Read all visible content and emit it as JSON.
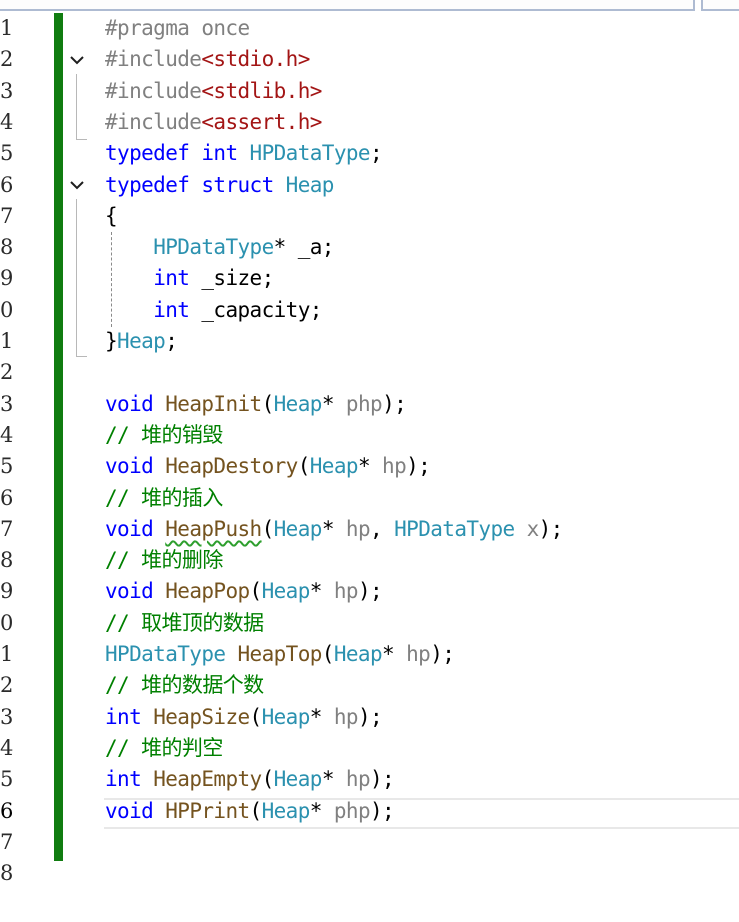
{
  "editor": {
    "line_numbers": [
      "1",
      "2",
      "3",
      "4",
      "5",
      "6",
      "7",
      "8",
      "9",
      "0",
      "1",
      "2",
      "3",
      "4",
      "5",
      "6",
      "7",
      "8",
      "9",
      "0",
      "1",
      "2",
      "3",
      "4",
      "5",
      "6",
      "7",
      "8"
    ],
    "current_line_index": 25,
    "colors": {
      "keyword": "#0000ff",
      "type": "#2b91af",
      "preprocessor": "#808080",
      "string": "#a31515",
      "function": "#74531f",
      "comment": "#008000",
      "change_bar": "#107c10"
    },
    "lines": [
      [
        {
          "t": "#pragma once",
          "c": "pp"
        }
      ],
      [
        {
          "t": "#include",
          "c": "pp"
        },
        {
          "t": "<stdio.h>",
          "c": "str"
        }
      ],
      [
        {
          "t": "#include",
          "c": "pp"
        },
        {
          "t": "<stdlib.h>",
          "c": "str"
        }
      ],
      [
        {
          "t": "#include",
          "c": "pp"
        },
        {
          "t": "<assert.h>",
          "c": "str"
        }
      ],
      [
        {
          "t": "typedef",
          "c": "kw"
        },
        {
          "t": " ",
          "c": "punc"
        },
        {
          "t": "int",
          "c": "kw"
        },
        {
          "t": " ",
          "c": "punc"
        },
        {
          "t": "HPDataType",
          "c": "ty"
        },
        {
          "t": ";",
          "c": "punc"
        }
      ],
      [
        {
          "t": "typedef",
          "c": "kw"
        },
        {
          "t": " ",
          "c": "punc"
        },
        {
          "t": "struct",
          "c": "kw"
        },
        {
          "t": " ",
          "c": "punc"
        },
        {
          "t": "Heap",
          "c": "ty"
        }
      ],
      [
        {
          "t": "{",
          "c": "punc"
        }
      ],
      [
        {
          "t": "    ",
          "c": "punc"
        },
        {
          "t": "HPDataType",
          "c": "ty"
        },
        {
          "t": "* _a;",
          "c": "punc"
        }
      ],
      [
        {
          "t": "    ",
          "c": "punc"
        },
        {
          "t": "int",
          "c": "kw"
        },
        {
          "t": " _size;",
          "c": "punc"
        }
      ],
      [
        {
          "t": "    ",
          "c": "punc"
        },
        {
          "t": "int",
          "c": "kw"
        },
        {
          "t": " _capacity;",
          "c": "punc"
        }
      ],
      [
        {
          "t": "}",
          "c": "punc"
        },
        {
          "t": "Heap",
          "c": "ty"
        },
        {
          "t": ";",
          "c": "punc"
        }
      ],
      [],
      [
        {
          "t": "void",
          "c": "kw"
        },
        {
          "t": " ",
          "c": "punc"
        },
        {
          "t": "HeapInit",
          "c": "fn"
        },
        {
          "t": "(",
          "c": "punc"
        },
        {
          "t": "Heap",
          "c": "ty"
        },
        {
          "t": "* ",
          "c": "punc"
        },
        {
          "t": "php",
          "c": "param"
        },
        {
          "t": ");",
          "c": "punc"
        }
      ],
      [
        {
          "t": "// 堆的销毁",
          "c": "cm"
        }
      ],
      [
        {
          "t": "void",
          "c": "kw"
        },
        {
          "t": " ",
          "c": "punc"
        },
        {
          "t": "HeapDestory",
          "c": "fn"
        },
        {
          "t": "(",
          "c": "punc"
        },
        {
          "t": "Heap",
          "c": "ty"
        },
        {
          "t": "* ",
          "c": "punc"
        },
        {
          "t": "hp",
          "c": "param"
        },
        {
          "t": ");",
          "c": "punc"
        }
      ],
      [
        {
          "t": "// 堆的插入",
          "c": "cm"
        }
      ],
      [
        {
          "t": "void",
          "c": "kw"
        },
        {
          "t": " ",
          "c": "punc"
        },
        {
          "t": "HeapPush",
          "c": "fn squiggle"
        },
        {
          "t": "(",
          "c": "punc"
        },
        {
          "t": "Heap",
          "c": "ty"
        },
        {
          "t": "* ",
          "c": "punc"
        },
        {
          "t": "hp",
          "c": "param"
        },
        {
          "t": ", ",
          "c": "punc"
        },
        {
          "t": "HPDataType",
          "c": "ty"
        },
        {
          "t": " ",
          "c": "punc"
        },
        {
          "t": "x",
          "c": "param"
        },
        {
          "t": ");",
          "c": "punc"
        }
      ],
      [
        {
          "t": "// 堆的删除",
          "c": "cm"
        }
      ],
      [
        {
          "t": "void",
          "c": "kw"
        },
        {
          "t": " ",
          "c": "punc"
        },
        {
          "t": "HeapPop",
          "c": "fn"
        },
        {
          "t": "(",
          "c": "punc"
        },
        {
          "t": "Heap",
          "c": "ty"
        },
        {
          "t": "* ",
          "c": "punc"
        },
        {
          "t": "hp",
          "c": "param"
        },
        {
          "t": ");",
          "c": "punc"
        }
      ],
      [
        {
          "t": "// 取堆顶的数据",
          "c": "cm"
        }
      ],
      [
        {
          "t": "HPDataType",
          "c": "ty"
        },
        {
          "t": " ",
          "c": "punc"
        },
        {
          "t": "HeapTop",
          "c": "fn"
        },
        {
          "t": "(",
          "c": "punc"
        },
        {
          "t": "Heap",
          "c": "ty"
        },
        {
          "t": "* ",
          "c": "punc"
        },
        {
          "t": "hp",
          "c": "param"
        },
        {
          "t": ");",
          "c": "punc"
        }
      ],
      [
        {
          "t": "// 堆的数据个数",
          "c": "cm"
        }
      ],
      [
        {
          "t": "int",
          "c": "kw"
        },
        {
          "t": " ",
          "c": "punc"
        },
        {
          "t": "HeapSize",
          "c": "fn"
        },
        {
          "t": "(",
          "c": "punc"
        },
        {
          "t": "Heap",
          "c": "ty"
        },
        {
          "t": "* ",
          "c": "punc"
        },
        {
          "t": "hp",
          "c": "param"
        },
        {
          "t": ");",
          "c": "punc"
        }
      ],
      [
        {
          "t": "// 堆的判空",
          "c": "cm"
        }
      ],
      [
        {
          "t": "int",
          "c": "kw"
        },
        {
          "t": " ",
          "c": "punc"
        },
        {
          "t": "HeapEmpty",
          "c": "fn"
        },
        {
          "t": "(",
          "c": "punc"
        },
        {
          "t": "Heap",
          "c": "ty"
        },
        {
          "t": "* ",
          "c": "punc"
        },
        {
          "t": "hp",
          "c": "param"
        },
        {
          "t": ");",
          "c": "punc"
        }
      ],
      [
        {
          "t": "void",
          "c": "kw"
        },
        {
          "t": " ",
          "c": "punc"
        },
        {
          "t": "HPPrint",
          "c": "fn"
        },
        {
          "t": "(",
          "c": "punc"
        },
        {
          "t": "Heap",
          "c": "ty"
        },
        {
          "t": "* ",
          "c": "punc"
        },
        {
          "t": "php",
          "c": "param"
        },
        {
          "t": ");",
          "c": "punc"
        }
      ],
      [],
      []
    ],
    "fold_icons": [
      {
        "line_index": 1,
        "icon": "chevron-down-icon",
        "region": "include-block"
      },
      {
        "line_index": 5,
        "icon": "chevron-down-icon",
        "region": "struct-heap"
      }
    ]
  }
}
